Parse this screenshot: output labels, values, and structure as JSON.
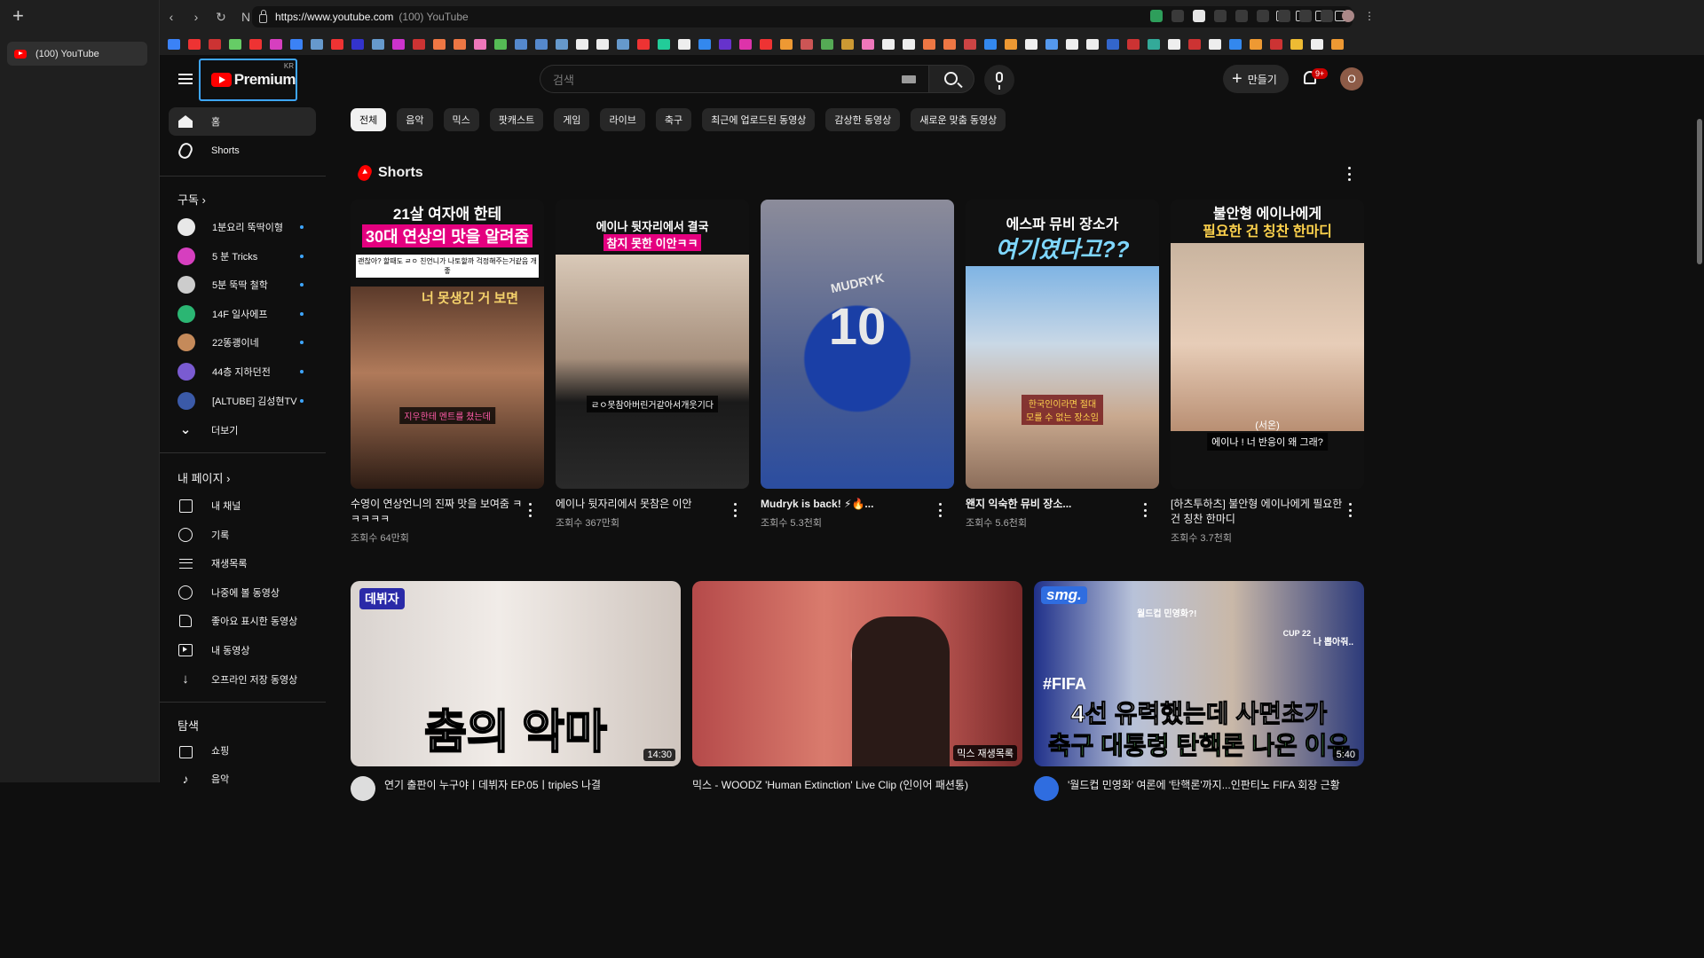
{
  "browser": {
    "tab_title": "(100) YouTube",
    "url": "https://www.youtube.com",
    "url_page_title": "(100) YouTube",
    "new_tab": "+"
  },
  "youtube": {
    "logo_text": "Premium",
    "logo_region": "KR",
    "search_placeholder": "검색",
    "create_label": "만들기",
    "notif_count": "9+",
    "avatar_letter": "O"
  },
  "sidebar": {
    "main": [
      {
        "label": "홈",
        "icon": "home-icon"
      },
      {
        "label": "Shorts",
        "icon": "shorts-icon"
      }
    ],
    "subs_header": "구독",
    "subs": [
      {
        "label": "1분요리 뚝딱이형",
        "color": "#e8e8e8"
      },
      {
        "label": "5 분 Tricks",
        "color": "#d63fbf"
      },
      {
        "label": "5분 뚝딱 철학",
        "color": "#cccccc"
      },
      {
        "label": "14F 일사에프",
        "color": "#2bb673"
      },
      {
        "label": "22똥괭이네",
        "color": "#c58a5a"
      },
      {
        "label": "44층 지하던전",
        "color": "#7a5bd1"
      },
      {
        "label": "[ALTUBE] 김성현TV",
        "color": "#3b5aa8"
      }
    ],
    "more_label": "더보기",
    "you_header": "내 페이지",
    "you": [
      {
        "label": "내 채널",
        "icon": "channel-icon"
      },
      {
        "label": "기록",
        "icon": "history-icon"
      },
      {
        "label": "재생목록",
        "icon": "playlist-icon"
      },
      {
        "label": "나중에 볼 동영상",
        "icon": "clock-icon"
      },
      {
        "label": "좋아요 표시한 동영상",
        "icon": "like-icon"
      },
      {
        "label": "내 동영상",
        "icon": "video-icon"
      },
      {
        "label": "오프라인 저장 동영상",
        "icon": "download-icon"
      }
    ],
    "explore_header": "탐색",
    "explore": [
      {
        "label": "쇼핑",
        "icon": "shopping-icon"
      },
      {
        "label": "음악",
        "icon": "music-icon"
      }
    ]
  },
  "chips": [
    "전체",
    "음악",
    "믹스",
    "팟캐스트",
    "게임",
    "라이브",
    "축구",
    "최근에 업로드된 동영상",
    "감상한 동영상",
    "새로운 맞춤 동영상"
  ],
  "shorts": {
    "header": "Shorts",
    "items": [
      {
        "title": "수영이 연상언니의 진짜 맛을 보여줌 ㅋㅋㅋㅋㅋ",
        "views": "조회수 64만회",
        "cap1": "21살 여자애 한테",
        "cap2": "30대 연상의 맛을 알려줌",
        "cap3": "괜찮아? 할때도 ㄹㅇ 친언니가 나토할까 걱정해주는거같음 개좋",
        "cap4": "너 못생긴 거 보면",
        "cap5": "지우한테 멘트를 쳤는데"
      },
      {
        "title": "에이나 뒷자리에서 못참은 이안",
        "views": "조회수 367만회",
        "cap1": "에이나 뒷자리에서 결국",
        "cap2": "참지 못한 이안ㅋㅋ",
        "cap3": "ㄹㅇ못참아버린거같아서개웃기다"
      },
      {
        "title": "Mudryk is back! ⚡🔥...",
        "views": "조회수 5.3천회",
        "cap1": "MUDRYK",
        "cap2": "10"
      },
      {
        "title": "왠지 익숙한 뮤비 장소...",
        "views": "조회수 5.6천회",
        "cap1": "에스파 뮤비 장소가",
        "cap2": "여기였다고??",
        "cap3": "한국인이라면 절대 모를 수 없는 장소임"
      },
      {
        "title": "[하츠투하츠] 불안형 에이나에게 필요한 건 칭찬 한마디",
        "views": "조회수 3.7천회",
        "cap1": "불안형 에이나에게",
        "cap2": "필요한 건 칭찬 한마디",
        "cap3": "(서온)",
        "cap4": "에이나 ! 너 반응이 왜 그래?"
      }
    ]
  },
  "videos": [
    {
      "title": "연기 출판이 누구야ㅣ데뷔자 EP.05ㅣtripleS 나결",
      "duration": "14:30",
      "overlay": "춤의 악마",
      "badge": "데뷔자"
    },
    {
      "title": "믹스 - WOODZ 'Human Extinction' Live Clip (인이어 패션통)",
      "duration": "믹스 재생목록",
      "overlay": ""
    },
    {
      "title": "'월드컵 민영화' 여론에 '탄핵론'까지...인판티노 FIFA 회장 근황",
      "duration": "5:40",
      "overlay1": "4선 유력했는데 사면초가",
      "overlay2": "축구 대통령 탄핵론 나온 이유",
      "tag": "#FIFA",
      "brand": "smg.",
      "quote1": "월드컵 민영화?!",
      "quote2": "나 뽑아줘..",
      "cup": "CUP 22"
    }
  ],
  "colors": {
    "accent": "#3ea6ff",
    "brand_red": "#ff0000",
    "bg": "#0f0f0f"
  }
}
